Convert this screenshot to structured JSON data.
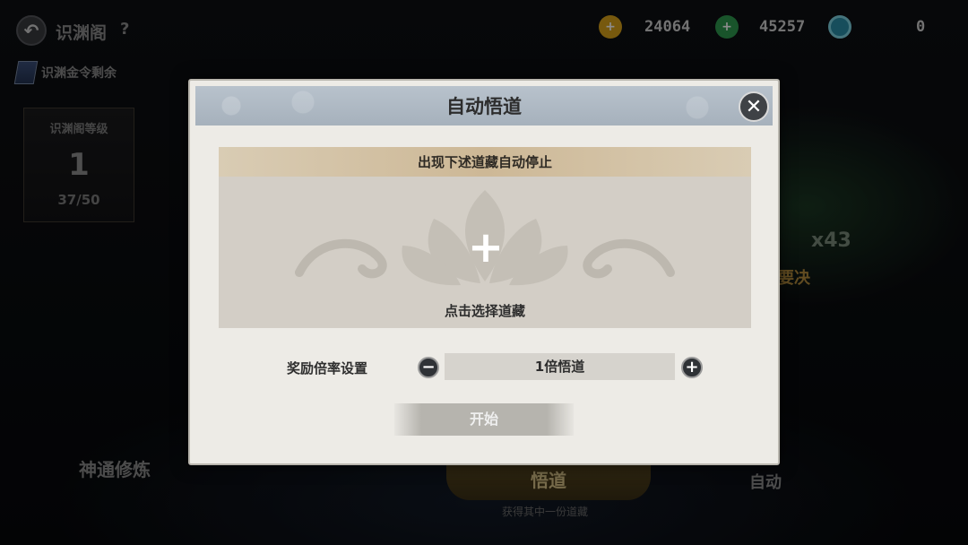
{
  "header": {
    "title": "识渊阁",
    "help": "?"
  },
  "currencies": [
    {
      "icon": "gold-ingot-icon",
      "value": "24064"
    },
    {
      "icon": "jade-icon",
      "value": "45257"
    },
    {
      "icon": "spirit-orb-icon",
      "value": "0"
    }
  ],
  "token": {
    "label": "识渊金令剩余"
  },
  "level_card": {
    "label": "识渊阁等级",
    "value": "1",
    "progress": "37/50"
  },
  "background_item": {
    "count": "x43",
    "name": "要决"
  },
  "bottom_nav": {
    "left": "神通修炼",
    "main": "悟道",
    "main_sub": "获得其中一份道藏",
    "auto": "自动"
  },
  "modal": {
    "title": "自动悟道",
    "stop_header": "出现下述道藏自动停止",
    "add_symbol": "+",
    "select_hint": "点击选择道藏",
    "multiplier_label": "奖励倍率设置",
    "multiplier_value": "1倍悟道",
    "minus": "−",
    "plus": "+",
    "start": "开始",
    "close": "✕"
  }
}
